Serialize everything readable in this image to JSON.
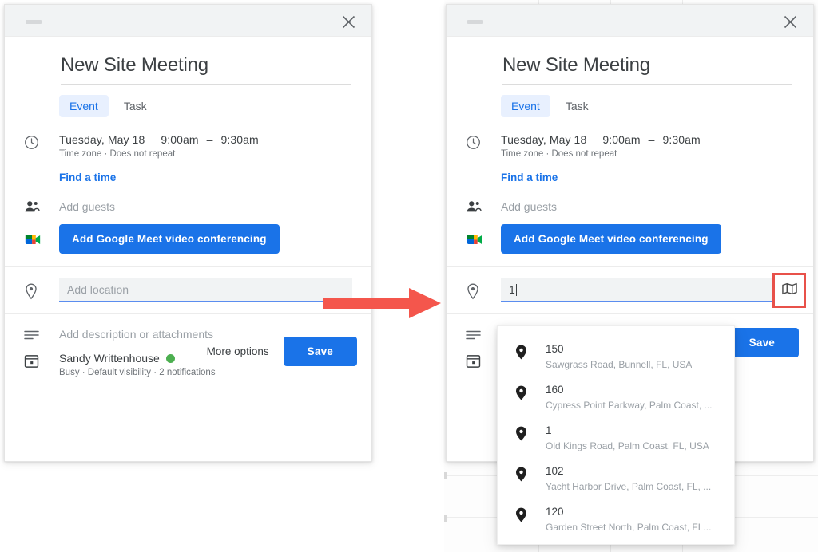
{
  "meta": {
    "accent_blue": "#1a73e8",
    "highlight_red": "#e8514a",
    "tab_active_bg": "#e8f0fe",
    "field_bg": "#f1f3f4"
  },
  "left_dialog": {
    "title": "New Site Meeting",
    "tabs": [
      {
        "label": "Event",
        "active": true
      },
      {
        "label": "Task",
        "active": false
      }
    ],
    "when": {
      "date": "Tuesday, May 18",
      "start_time": "9:00am",
      "dash": "–",
      "end_time": "9:30am",
      "sub": "Time zone · Does not repeat"
    },
    "find_a_time": "Find a time",
    "guests_placeholder": "Add guests",
    "meet_button": "Add Google Meet video conferencing",
    "location_placeholder": "Add location",
    "description_placeholder": "Add description or attachments",
    "owner": {
      "name": "Sandy Writtenhouse",
      "sub": "Busy · Default visibility · 2 notifications"
    },
    "footer": {
      "more_options": "More options",
      "save": "Save"
    }
  },
  "right_dialog": {
    "title": "New Site Meeting",
    "tabs": [
      {
        "label": "Event",
        "active": true
      },
      {
        "label": "Task",
        "active": false
      }
    ],
    "when": {
      "date": "Tuesday, May 18",
      "start_time": "9:00am",
      "dash": "–",
      "end_time": "9:30am",
      "sub": "Time zone · Does not repeat"
    },
    "find_a_time": "Find a time",
    "guests_placeholder": "Add guests",
    "meet_button": "Add Google Meet video conferencing",
    "location_value": "1",
    "location_placeholder": "Add location",
    "footer": {
      "save": "Save"
    }
  },
  "suggestions": [
    {
      "number": "150",
      "address": "Sawgrass Road, Bunnell, FL, USA"
    },
    {
      "number": "160",
      "address": "Cypress Point Parkway, Palm Coast, ..."
    },
    {
      "number": "1",
      "address": "Old Kings Road, Palm Coast, FL, USA"
    },
    {
      "number": "102",
      "address": "Yacht Harbor Drive, Palm Coast, FL, ..."
    },
    {
      "number": "120",
      "address": "Garden Street North, Palm Coast, FL..."
    }
  ]
}
